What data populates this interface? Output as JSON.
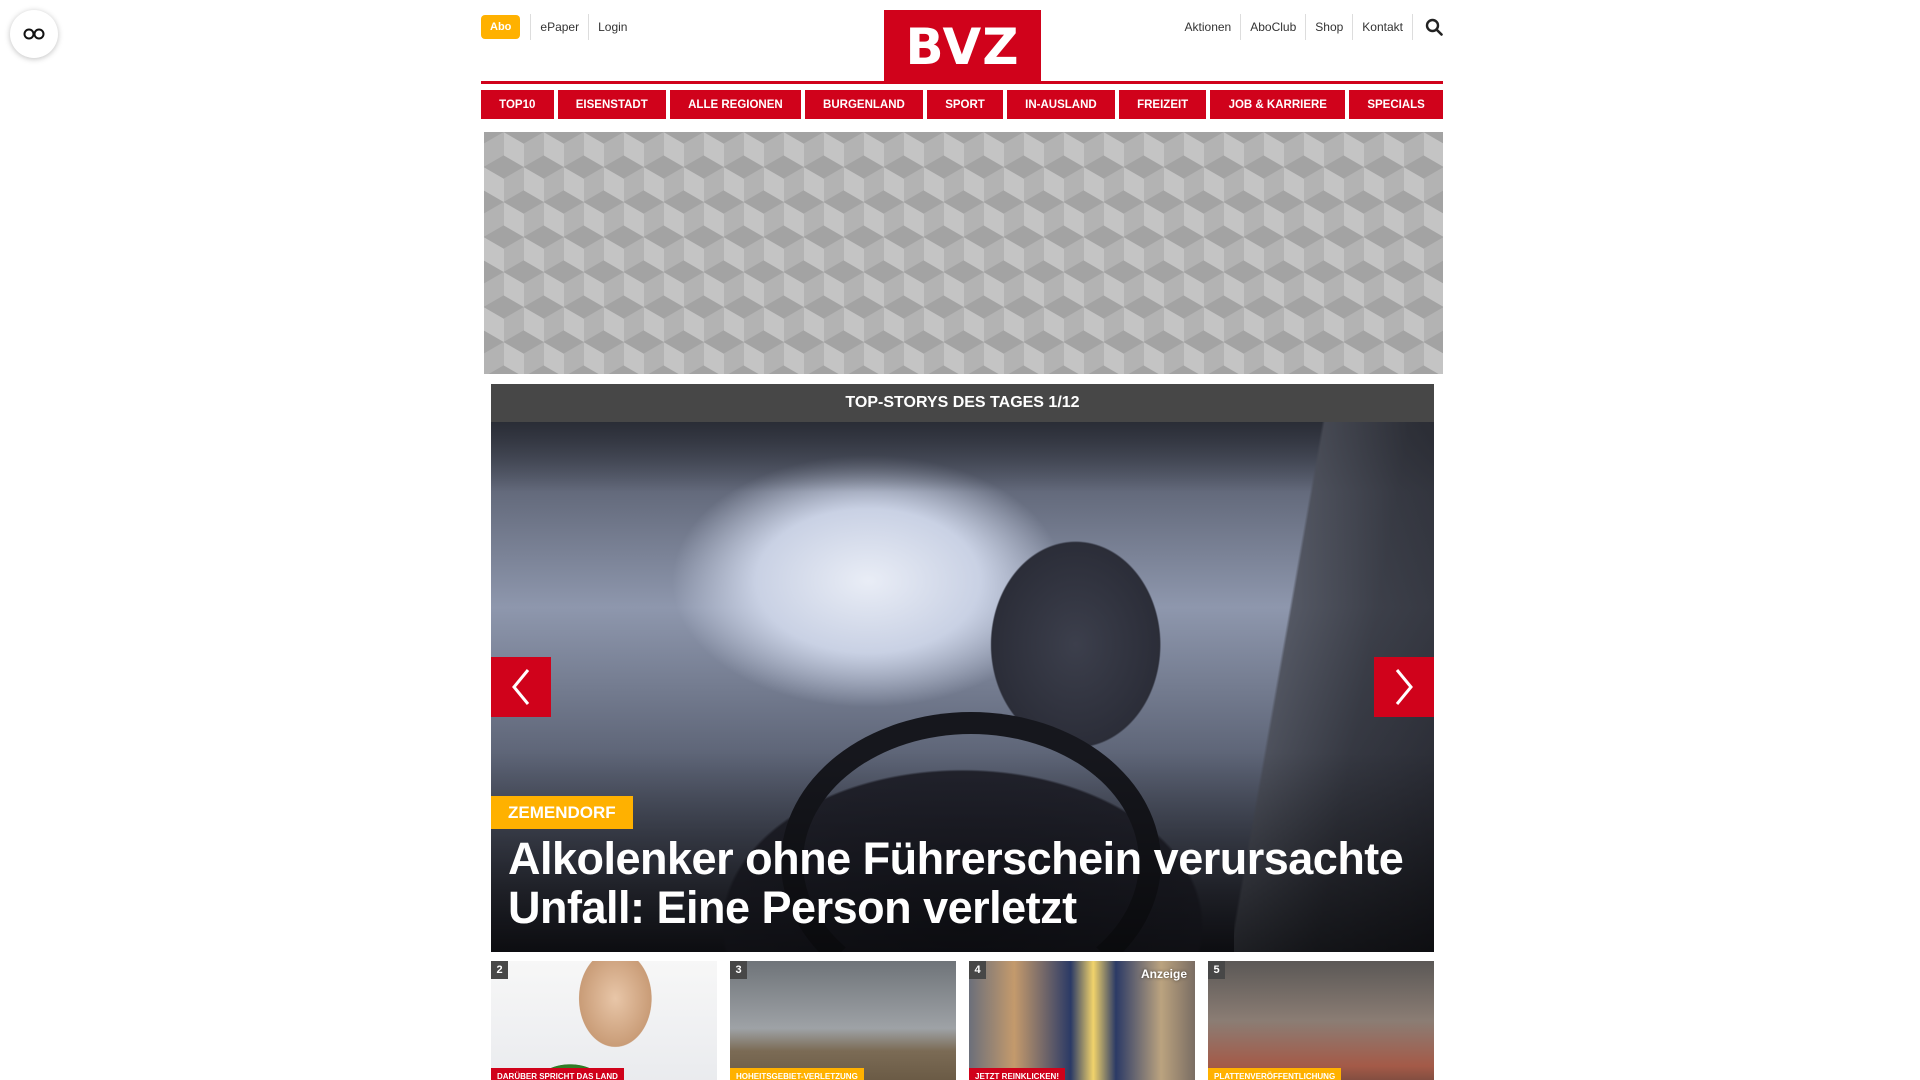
{
  "header": {
    "abo_label": "Abo",
    "left_links": [
      "ePaper",
      "Login"
    ],
    "logo_text": "BVZ",
    "right_links": [
      "Aktionen",
      "AboClub",
      "Shop",
      "Kontakt"
    ]
  },
  "nav": {
    "items": [
      "TOP10",
      "EISENSTADT",
      "ALLE REGIONEN",
      "BURGENLAND",
      "SPORT",
      "IN-AUSLAND",
      "FREIZEIT",
      "JOB & KARRIERE",
      "SPECIALS"
    ]
  },
  "stories": {
    "header": "TOP-STORYS DES TAGES 1/12",
    "hero": {
      "tag": "ZEMENDORF",
      "title": "Alkolenker ohne Führerschein verursachte Unfall: Eine Person verletzt"
    },
    "thumbs": [
      {
        "num": "2",
        "label": "DARÜBER SPRICHT DAS LAND",
        "label_color": "#d0021b"
      },
      {
        "num": "3",
        "label": "HOHEITSGEBIET-VERLETZUNG",
        "label_color": "#ffb100"
      },
      {
        "num": "4",
        "label": "JETZT REINKLICKEN!",
        "label_color": "#d0021b",
        "anzeige": "Anzeige"
      },
      {
        "num": "5",
        "label": "PLATTENVERÖFFENTLICHUNG",
        "label_color": "#ffb100"
      }
    ]
  },
  "colors": {
    "brand_red": "#d0021b",
    "accent_yellow": "#ffb100",
    "header_gray": "#474747"
  },
  "icons": {
    "a11y": "glasses-icon",
    "search": "search-icon",
    "prev": "chevron-left-icon",
    "next": "chevron-right-icon"
  }
}
